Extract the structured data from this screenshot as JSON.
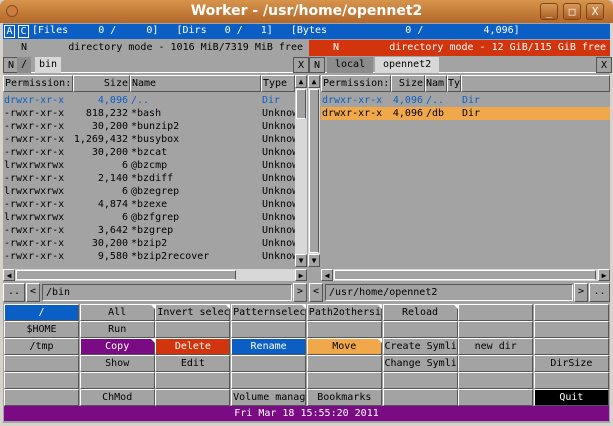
{
  "window": {
    "title": "Worker - /usr/home/opennet2",
    "min": "_",
    "max": "□",
    "close": "X"
  },
  "status": {
    "a": "A",
    "c": "C",
    "text": "[Files     0 /     0]   [Dirs   0 /   1]   [Bytes             0 /          4,096]"
  },
  "left": {
    "mode_n": "N",
    "mode_text": "directory mode - 1016 MiB/7319 MiB free",
    "tab_n": "N",
    "tabs": [
      "/",
      "bin"
    ],
    "tab_close": "X",
    "columns": [
      "Permission:",
      "Size",
      "Name",
      "Type"
    ],
    "rows": [
      [
        "drwxr-xr-x",
        "4,096",
        "/..",
        "Dir"
      ],
      [
        "-rwxr-xr-x",
        "818,232",
        "*bash",
        "Unknow"
      ],
      [
        "-rwxr-xr-x",
        "30,200",
        "*bunzip2",
        "Unknow"
      ],
      [
        "-rwxr-xr-x",
        "1,269,432",
        "*busybox",
        "Unknow"
      ],
      [
        "-rwxr-xr-x",
        "30,200",
        "*bzcat",
        "Unknow"
      ],
      [
        "lrwxrwxrwx",
        "6",
        "@bzcmp",
        "Unknow"
      ],
      [
        "-rwxr-xr-x",
        "2,140",
        "*bzdiff",
        "Unknow"
      ],
      [
        "lrwxrwxrwx",
        "6",
        "@bzegrep",
        "Unknow"
      ],
      [
        "-rwxr-xr-x",
        "4,874",
        "*bzexe",
        "Unknow"
      ],
      [
        "lrwxrwxrwx",
        "6",
        "@bzfgrep",
        "Unknow"
      ],
      [
        "-rwxr-xr-x",
        "3,642",
        "*bzgrep",
        "Unknow"
      ],
      [
        "-rwxr-xr-x",
        "30,200",
        "*bzip2",
        "Unknow"
      ],
      [
        "-rwxr-xr-x",
        "9,580",
        "*bzip2recover",
        "Unknow"
      ]
    ],
    "path": "/bin",
    "parent": "..",
    "back": "<",
    "fwd": ">"
  },
  "right": {
    "mode_n": "N",
    "mode_text": "directory mode - 12 GiB/115 GiB free",
    "tab_n": "N",
    "tabs": [
      "local",
      "opennet2"
    ],
    "tab_close": "X",
    "columns": [
      "Permission:",
      "Size",
      "Nam",
      "Ty"
    ],
    "rows": [
      [
        "drwxr-xr-x",
        "4,096",
        "/..",
        "Dir"
      ],
      [
        "drwxr-xr-x",
        "4,096",
        "/db",
        "Dir"
      ]
    ],
    "path": "/usr/home/opennet2",
    "parent": "..",
    "back": "<",
    "fwd": ">"
  },
  "buttons": [
    [
      "/",
      "All",
      "Invert selec",
      "Patternselec",
      "Path2othersi",
      "Reload",
      "",
      ""
    ],
    [
      "$HOME",
      "Run",
      "",
      "",
      "",
      "",
      "",
      ""
    ],
    [
      "/tmp",
      "Copy",
      "Delete",
      "Rename",
      "Move",
      "Create Symli",
      "new dir",
      ""
    ],
    [
      "",
      "Show",
      "Edit",
      "",
      "",
      "Change Symli",
      "",
      "DirSize"
    ],
    [
      "",
      "",
      "",
      "",
      "",
      "",
      "",
      ""
    ],
    [
      "",
      "ChMod",
      "",
      "Volume manag",
      "Bookmarks",
      "",
      "",
      "Quit"
    ]
  ],
  "clock": "Fri Mar 18 15:55:20 2011",
  "colors": {
    "blue": "#0b5fc4",
    "red": "#d2350d",
    "purple": "#7a0b85",
    "orange": "#f0a84a"
  }
}
